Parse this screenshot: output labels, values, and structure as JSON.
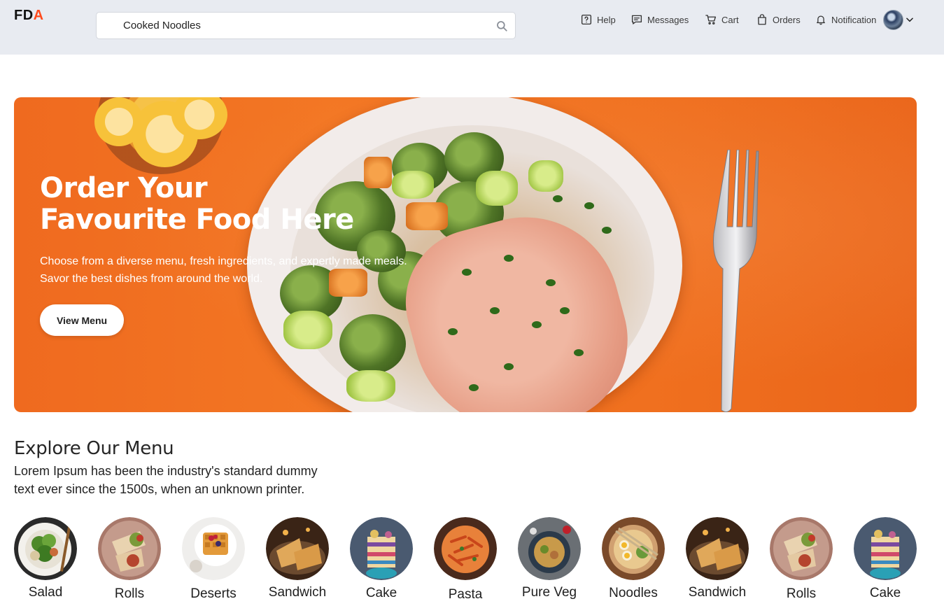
{
  "header": {
    "logo_prefix": "FD",
    "logo_accent": "A",
    "search_value": "Cooked Noodles",
    "nav": {
      "help": "Help",
      "messages": "Messages",
      "cart": "Cart",
      "orders": "Orders",
      "notification": "Notification"
    }
  },
  "hero": {
    "title_line1": "Order Your",
    "title_line2": "Favourite Food Here",
    "desc_line1": "Choose from a diverse menu, fresh ingredients, and expertly made meals.",
    "desc_line2": "Savor the best dishes from around the world.",
    "button": "View Menu"
  },
  "explore": {
    "title": "Explore Our Menu",
    "desc_line1": "Lorem Ipsum has been the industry's standard dummy",
    "desc_line2": "text ever since the 1500s, when an unknown printer."
  },
  "menu": [
    {
      "label": "Salad",
      "icon": "salad-thumb"
    },
    {
      "label": "Rolls",
      "icon": "rolls-thumb"
    },
    {
      "label": "Deserts",
      "icon": "deserts-thumb"
    },
    {
      "label": "Sandwich",
      "icon": "sandwich-thumb"
    },
    {
      "label": "Cake",
      "icon": "cake-thumb"
    },
    {
      "label": "Pasta",
      "icon": "pasta-thumb"
    },
    {
      "label": "Pure Veg",
      "icon": "pure-veg-thumb"
    },
    {
      "label": "Noodles",
      "icon": "noodles-thumb"
    },
    {
      "label": "Sandwich",
      "icon": "sandwich-thumb"
    },
    {
      "label": "Rolls",
      "icon": "rolls-thumb"
    },
    {
      "label": "Cake",
      "icon": "cake-thumb"
    }
  ],
  "colors": {
    "accent": "#ff4a1c",
    "hero_orange": "#f0701f",
    "header_bg": "#e8ebf1"
  }
}
